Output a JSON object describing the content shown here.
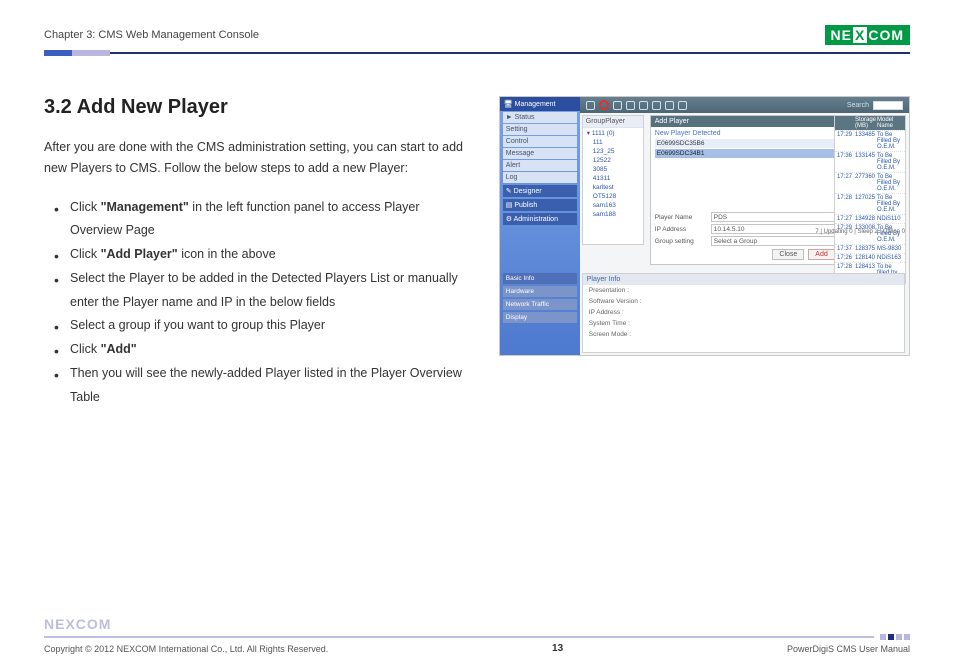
{
  "header": {
    "chapter": "Chapter 3: CMS Web Management Console",
    "brand_left": "NE",
    "brand_mid": "X",
    "brand_right": "COM"
  },
  "section": {
    "title": "3.2 Add New Player",
    "intro": "After you are done with the CMS administration setting, you can start to add new Players to CMS. Follow the below steps to add a new Player:",
    "steps": {
      "s1a": "Click ",
      "s1b": "\"Management\"",
      "s1c": " in the left function panel to access Player Overview Page",
      "s2a": "Click ",
      "s2b": "\"Add Player\"",
      "s2c": " icon in the above",
      "s3": "Select the Player to be added in the Detected Players List or manually enter the Player name and IP in the below fields",
      "s4": "Select a group if you want to group this Player",
      "s5a": "Click ",
      "s5b": "\"Add\"",
      "s6": "Then you will see the newly-added Player listed in the Player Overview Table"
    }
  },
  "screenshot": {
    "sidebar": {
      "header": "Management",
      "items": [
        "► Status",
        "Setting",
        "Control",
        "Message",
        "Alert",
        "Log"
      ],
      "sections": [
        "Designer",
        "Publish",
        "Administration"
      ]
    },
    "toolbar": {
      "search_label": "Search"
    },
    "tree": {
      "header": "GroupPlayer",
      "root": "▾ 1111 (0)",
      "nodes": [
        "111",
        "123_25",
        "12522",
        "3085",
        "41311",
        "karltest",
        "OT5128",
        "sam163",
        "sam188"
      ]
    },
    "dialog": {
      "title": "Add Player",
      "detected_label": "New Player Detected",
      "rows": [
        "E0699SDC35B6",
        "E0699SDC34B1"
      ],
      "fields": {
        "name_label": "Player Name",
        "name_value": "PDS",
        "ip_label": "IP Address",
        "ip_value": "10.14.5.10",
        "group_label": "Group setting",
        "group_value": "Select a Group"
      },
      "close": "Close",
      "add": "Add"
    },
    "right_table": {
      "headers": [
        "",
        "Storage (MB)",
        "Model Name"
      ],
      "rows": [
        [
          "17:29",
          "133485",
          "To Be Filled By O.E.M."
        ],
        [
          "17:36",
          "133145",
          "To Be Filled By O.E.M."
        ],
        [
          "17:27",
          "277360",
          "To Be Filled By O.E.M."
        ],
        [
          "17:28",
          "127025",
          "To Be Filled By O.E.M."
        ],
        [
          "17:27",
          "134928",
          "NDiS110"
        ],
        [
          "17:29",
          "133008",
          "To Be Filled By O.E.M."
        ],
        [
          "17:37",
          "128375",
          "MS-9830"
        ],
        [
          "17:26",
          "128140",
          "NDiS163"
        ],
        [
          "17:28",
          "128413",
          "To be filled by O.E.M."
        ]
      ],
      "status": "7  |  Updating  0  |  Sleep  2  |  Offline  0"
    },
    "lower": {
      "tabs": [
        "Basic Info",
        "Hardware",
        "Network Traffic",
        "Display"
      ],
      "panel_title": "Player Info",
      "panel_rows": [
        "Presentation :",
        "Software Version :",
        "IP Address :",
        "System Time :",
        "Screen Mode :"
      ]
    }
  },
  "footer": {
    "brand": "NEXCOM",
    "copyright": "Copyright © 2012 NEXCOM International Co., Ltd. All Rights Reserved.",
    "page_no": "13",
    "manual": "PowerDigiS CMS User Manual"
  }
}
